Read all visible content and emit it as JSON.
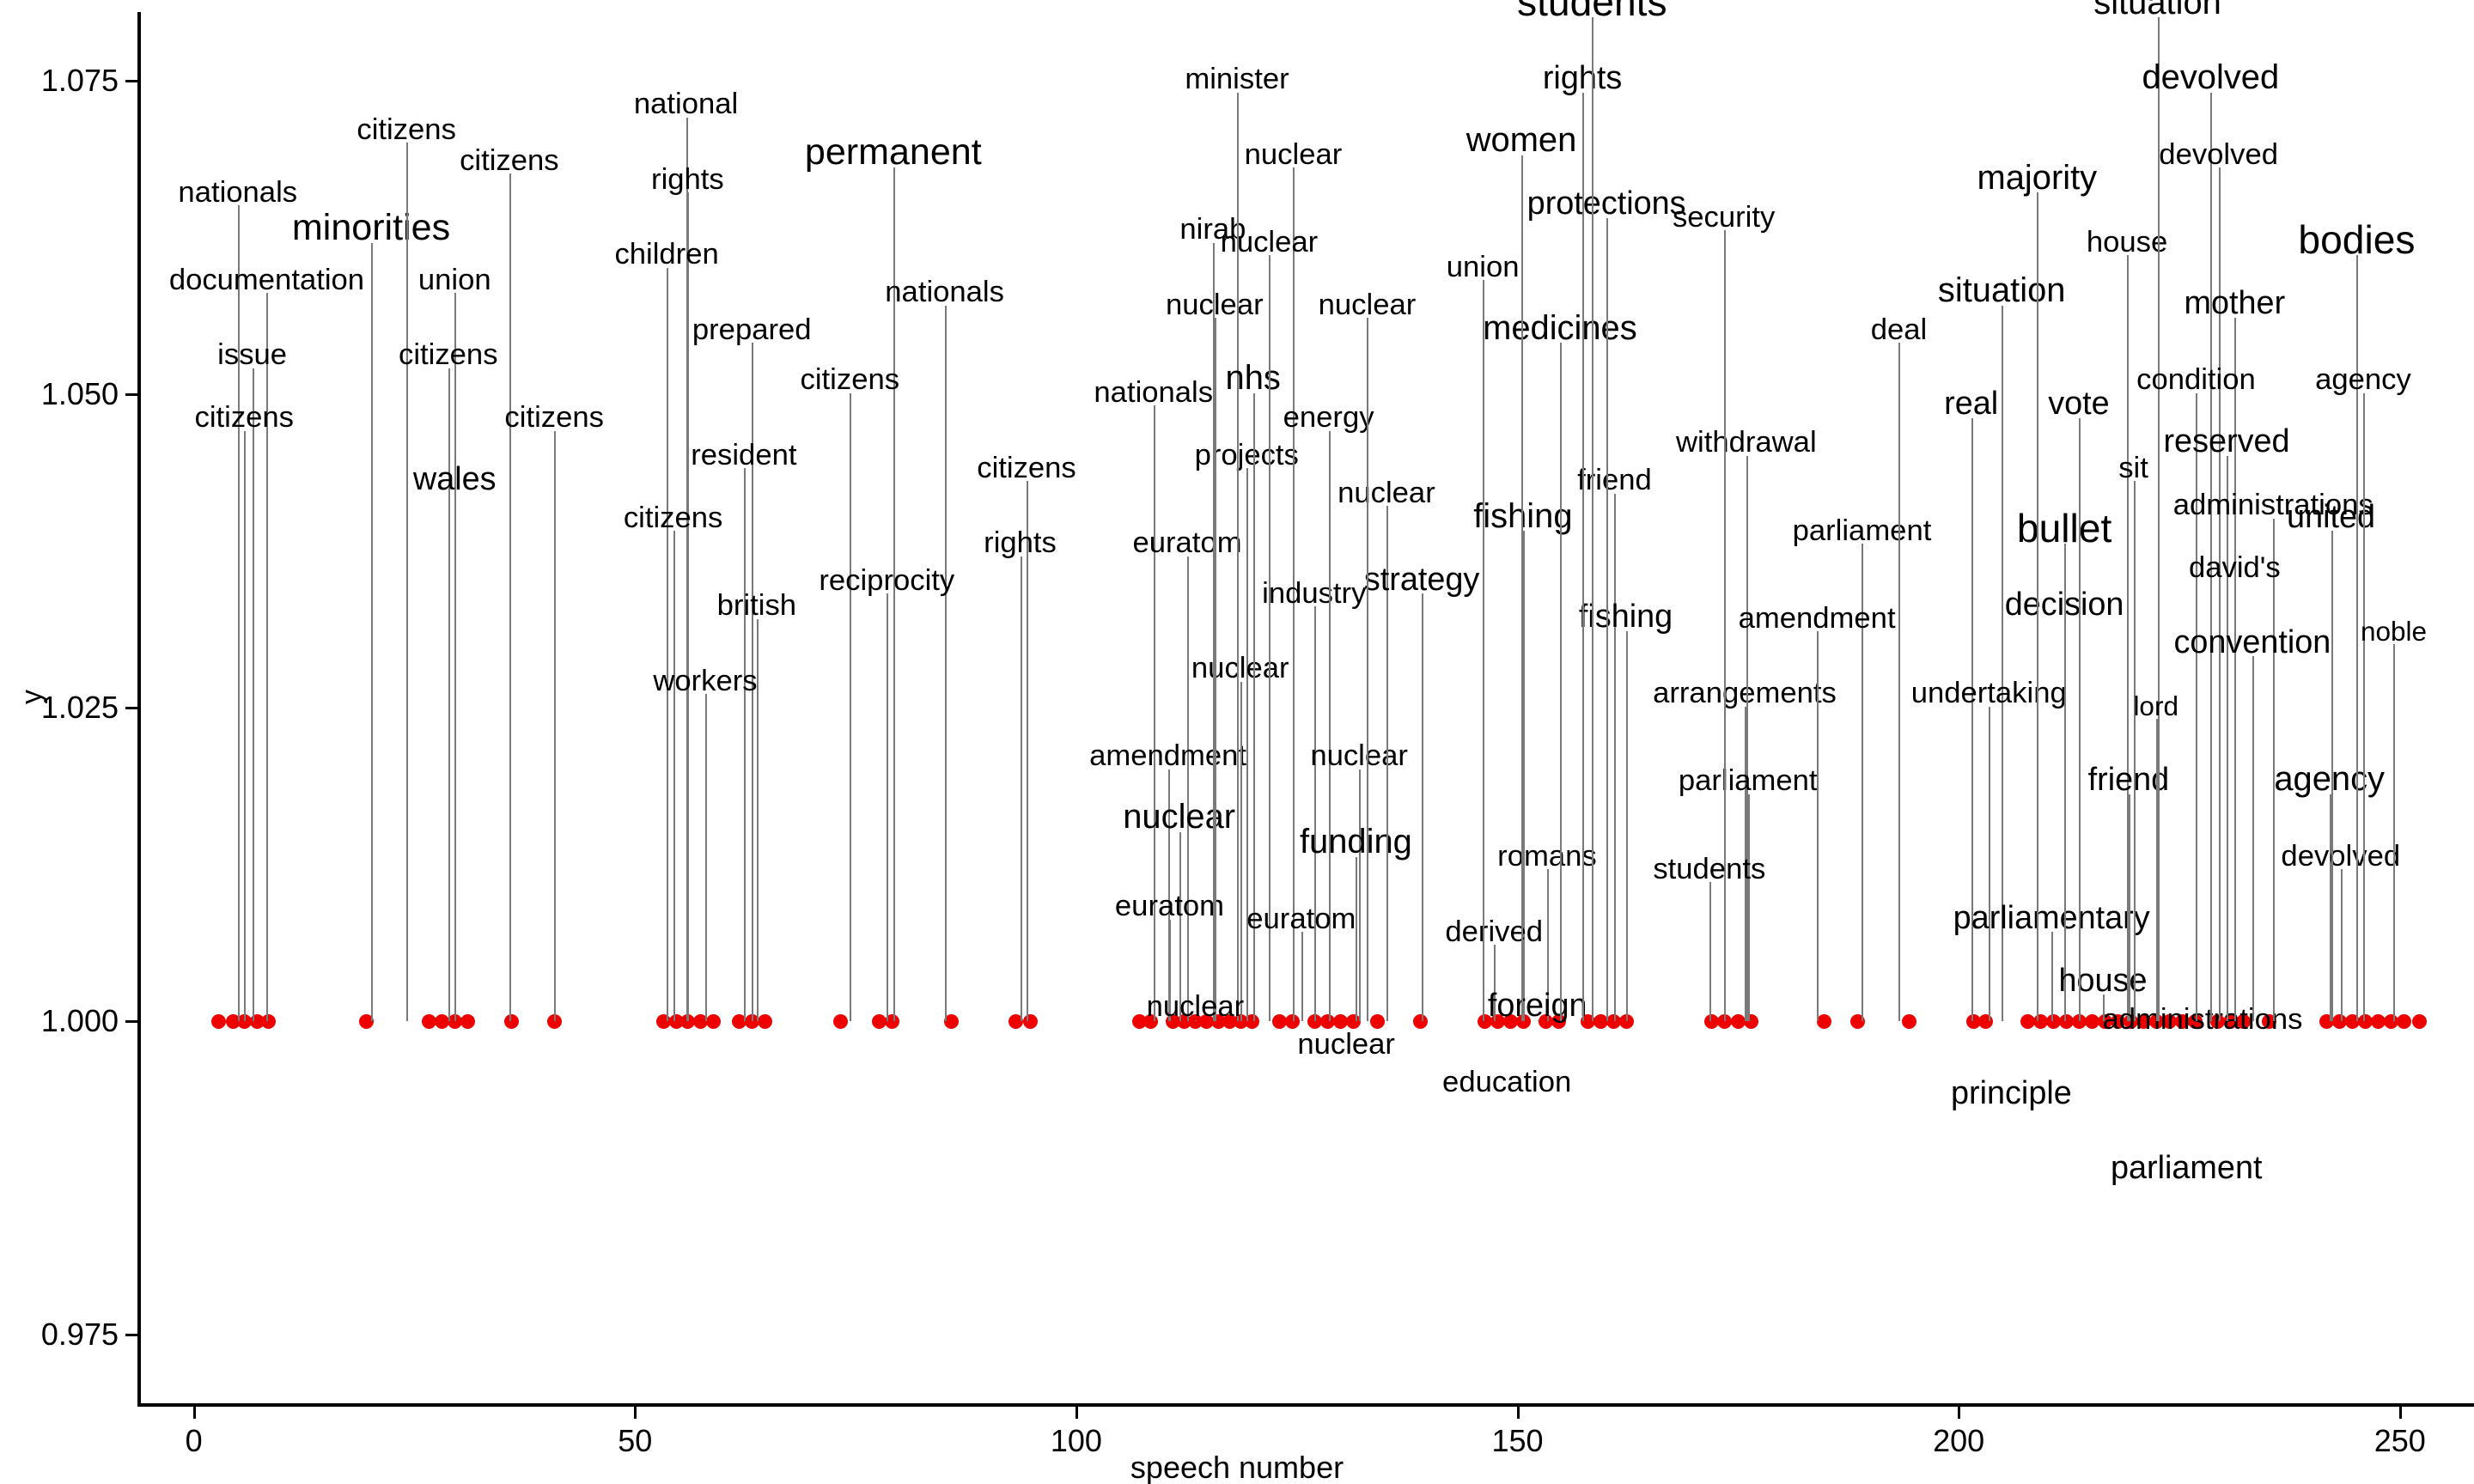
{
  "chart_data": {
    "type": "scatter",
    "title": "",
    "subtitle": "",
    "xlabel": "speech number",
    "ylabel": "y",
    "xlim": [
      -6,
      258
    ],
    "ylim": [
      0.9695,
      1.0805
    ],
    "grid": false,
    "legend": "none",
    "point_color": "#ee0000",
    "stem_color": "#7a7a7a",
    "xticks": [
      0,
      50,
      100,
      150,
      200,
      250
    ],
    "xtick_labels": [
      "0",
      "50",
      "100",
      "150",
      "200",
      "250"
    ],
    "yticks": [
      0.975,
      1.0,
      1.025,
      1.05,
      1.075
    ],
    "ytick_labels": [
      "0.975",
      "1.000",
      "1.025",
      "1.050",
      "1.075"
    ],
    "series_note": "every point lies at y = 1.000; each point carries a text label placed above it and joined by a thin leader line",
    "points": [
      {
        "x": 2,
        "y": 1.0,
        "label": "nationals",
        "label_y": 1.0655,
        "size": 33,
        "lx": 148
      },
      {
        "x": 3,
        "y": 1.0,
        "label": "documentation",
        "label_y": 1.0585,
        "size": 33,
        "lx": 166
      },
      {
        "x": 3,
        "y": 1.0,
        "label": "issue",
        "label_y": 1.0525,
        "size": 33,
        "lx": 157
      },
      {
        "x": 4,
        "y": 1.0,
        "label": "citizens",
        "label_y": 1.0475,
        "size": 33,
        "lx": 152
      },
      {
        "x": 5,
        "y": 1.0,
        "label": "minorities",
        "label_y": 1.0625,
        "size": 41,
        "lx": 231
      },
      {
        "x": 16,
        "y": 1.0,
        "label": "citizens",
        "label_y": 1.0705,
        "size": 33,
        "lx": 253
      },
      {
        "x": 23,
        "y": 1.0,
        "label": "union",
        "label_y": 1.0585,
        "size": 33,
        "lx": 283
      },
      {
        "x": 24,
        "y": 1.0,
        "label": "citizens",
        "label_y": 1.068,
        "size": 33,
        "lx": 317
      },
      {
        "x": 25,
        "y": 1.0,
        "label": "citizens",
        "label_y": 1.0525,
        "size": 33,
        "lx": 279
      },
      {
        "x": 26,
        "y": 1.0,
        "label": "wales",
        "label_y": 1.0425,
        "size": 36,
        "lx": 283
      },
      {
        "x": 27,
        "y": 1.0,
        "label": "citizens",
        "label_y": 1.0475,
        "size": 33,
        "lx": 345
      },
      {
        "x": 33,
        "y": 1.0,
        "label": "",
        "label_y": 1.0,
        "size": 0,
        "lx": 0
      },
      {
        "x": 37,
        "y": 1.0,
        "label": "",
        "label_y": 1.0,
        "size": 0,
        "lx": 0
      },
      {
        "x": 50,
        "y": 1.0,
        "label": "national",
        "label_y": 1.0725,
        "size": 33,
        "lx": 427
      },
      {
        "x": 51,
        "y": 1.0,
        "label": "rights",
        "label_y": 1.0665,
        "size": 33,
        "lx": 428
      },
      {
        "x": 51,
        "y": 1.0,
        "label": "children",
        "label_y": 1.0605,
        "size": 33,
        "lx": 415
      },
      {
        "x": 52,
        "y": 1.0,
        "label": "prepared",
        "label_y": 1.0545,
        "size": 33,
        "lx": 468
      },
      {
        "x": 53,
        "y": 1.0,
        "label": "resident",
        "label_y": 1.0445,
        "size": 33,
        "lx": 463
      },
      {
        "x": 53,
        "y": 1.0,
        "label": "citizens",
        "label_y": 1.0395,
        "size": 33,
        "lx": 419
      },
      {
        "x": 54,
        "y": 1.0,
        "label": "british",
        "label_y": 1.0325,
        "size": 33,
        "lx": 471
      },
      {
        "x": 55,
        "y": 1.0,
        "label": "workers",
        "label_y": 1.0265,
        "size": 33,
        "lx": 439
      },
      {
        "x": 59,
        "y": 1.0,
        "label": "permanent",
        "label_y": 1.0685,
        "size": 41,
        "lx": 556
      },
      {
        "x": 60,
        "y": 1.0,
        "label": "citizens",
        "label_y": 1.0505,
        "size": 33,
        "lx": 529
      },
      {
        "x": 61,
        "y": 1.0,
        "label": "nationals",
        "label_y": 1.0575,
        "size": 33,
        "lx": 588
      },
      {
        "x": 71,
        "y": 1.0,
        "label": "reciprocity",
        "label_y": 1.0345,
        "size": 33,
        "lx": 552
      },
      {
        "x": 75,
        "y": 1.0,
        "label": "citizens",
        "label_y": 1.0435,
        "size": 33,
        "lx": 639
      },
      {
        "x": 76,
        "y": 1.0,
        "label": "rights",
        "label_y": 1.0375,
        "size": 33,
        "lx": 635
      },
      {
        "x": 84,
        "y": 1.0,
        "label": "",
        "label_y": 1.0,
        "size": 0,
        "lx": 0
      },
      {
        "x": 91,
        "y": 1.0,
        "label": "",
        "label_y": 1.0,
        "size": 0,
        "lx": 0
      },
      {
        "x": 92,
        "y": 1.0,
        "label": "",
        "label_y": 1.0,
        "size": 0,
        "lx": 0
      },
      {
        "x": 105,
        "y": 1.0,
        "label": "nationals",
        "label_y": 1.0495,
        "size": 33,
        "lx": 718
      },
      {
        "x": 107,
        "y": 1.0,
        "label": "euratom",
        "label_y": 1.0375,
        "size": 33,
        "lx": 739
      },
      {
        "x": 108,
        "y": 1.0,
        "label": "projects",
        "label_y": 1.0445,
        "size": 33,
        "lx": 776
      },
      {
        "x": 109,
        "y": 1.0,
        "label": "amendment",
        "label_y": 1.0205,
        "size": 33,
        "lx": 727
      },
      {
        "x": 110,
        "y": 1.0,
        "label": "nuclear",
        "label_y": 1.0275,
        "size": 33,
        "lx": 772
      },
      {
        "x": 111,
        "y": 1.0,
        "label": "nuclear",
        "label_y": 1.0155,
        "size": 38,
        "lx": 734
      },
      {
        "x": 112,
        "y": 1.0,
        "label": "euratom",
        "label_y": 1.0085,
        "size": 33,
        "lx": 728
      },
      {
        "x": 113,
        "y": 1.0,
        "label": "nirab",
        "label_y": 1.0625,
        "size": 33,
        "lx": 755
      },
      {
        "x": 114,
        "y": 1.0,
        "label": "nuclear",
        "label_y": 1.0565,
        "size": 33,
        "lx": 756
      },
      {
        "x": 115,
        "y": 1.0,
        "label": "minister",
        "label_y": 1.0745,
        "size": 33,
        "lx": 770
      },
      {
        "x": 116,
        "y": 1.0,
        "label": "nuclear",
        "label_y": 1.0685,
        "size": 33,
        "lx": 805
      },
      {
        "x": 117,
        "y": 1.0,
        "label": "nhs",
        "label_y": 1.0505,
        "size": 38,
        "lx": 780
      },
      {
        "x": 118,
        "y": 1.0,
        "label": "nuclear",
        "label_y": 1.0615,
        "size": 33,
        "lx": 790
      },
      {
        "x": 119,
        "y": 1.0,
        "label": "nuclear",
        "label_y": 1.0005,
        "size": 33,
        "lx": 744
      },
      {
        "x": 121,
        "y": 1.0,
        "label": "industry",
        "label_y": 1.0335,
        "size": 33,
        "lx": 818
      },
      {
        "x": 122,
        "y": 1.0,
        "label": "energy",
        "label_y": 1.0475,
        "size": 33,
        "lx": 827
      },
      {
        "x": 123,
        "y": 1.0,
        "label": "euratom",
        "label_y": 1.0075,
        "size": 33,
        "lx": 810
      },
      {
        "x": 124,
        "y": 1.0,
        "label": "nuclear",
        "label_y": 1.0205,
        "size": 33,
        "lx": 846
      },
      {
        "x": 125,
        "y": 1.0,
        "label": "funding",
        "label_y": 1.0135,
        "size": 38,
        "lx": 844
      },
      {
        "x": 126,
        "y": 1.0,
        "label": "nuclear",
        "label_y": 0.9975,
        "size": 33,
        "lx": 838
      },
      {
        "x": 128,
        "y": 1.0,
        "label": "nuclear",
        "label_y": 1.0415,
        "size": 33,
        "lx": 863
      },
      {
        "x": 130,
        "y": 1.0,
        "label": "strategy",
        "label_y": 1.0345,
        "size": 36,
        "lx": 885
      },
      {
        "x": 133,
        "y": 1.0,
        "label": "nuclear",
        "label_y": 1.0565,
        "size": 33,
        "lx": 851
      },
      {
        "x": 139,
        "y": 1.0,
        "label": "",
        "label_y": 1.0,
        "size": 0,
        "lx": 0
      },
      {
        "x": 145,
        "y": 1.0,
        "label": "fishing",
        "label_y": 1.0395,
        "size": 38,
        "lx": 948
      },
      {
        "x": 146,
        "y": 1.0,
        "label": "romans",
        "label_y": 1.0125,
        "size": 33,
        "lx": 963
      },
      {
        "x": 147,
        "y": 1.0,
        "label": "derived",
        "label_y": 1.0065,
        "size": 33,
        "lx": 930
      },
      {
        "x": 148,
        "y": 1.0,
        "label": "foreign",
        "label_y": 1.0005,
        "size": 36,
        "lx": 957
      },
      {
        "x": 149,
        "y": 1.0,
        "label": "education",
        "label_y": 0.9945,
        "size": 33,
        "lx": 938
      },
      {
        "x": 151,
        "y": 1.0,
        "label": "friend",
        "label_y": 1.0425,
        "size": 33,
        "lx": 1005
      },
      {
        "x": 153,
        "y": 1.0,
        "label": "fishing",
        "label_y": 1.0315,
        "size": 36,
        "lx": 1012
      },
      {
        "x": 155,
        "y": 1.0,
        "label": "medicines",
        "label_y": 1.0545,
        "size": 38,
        "lx": 971
      },
      {
        "x": 157,
        "y": 1.0,
        "label": "union",
        "label_y": 1.0595,
        "size": 33,
        "lx": 923
      },
      {
        "x": 158,
        "y": 1.0,
        "label": "protections",
        "label_y": 1.0645,
        "size": 36,
        "lx": 1000
      },
      {
        "x": 158,
        "y": 1.0,
        "label": "women",
        "label_y": 1.0695,
        "size": 38,
        "lx": 947
      },
      {
        "x": 159,
        "y": 1.0,
        "label": "rights",
        "label_y": 1.0745,
        "size": 36,
        "lx": 985
      },
      {
        "x": 159,
        "y": 1.0,
        "label": "students",
        "label_y": 1.0805,
        "size": 44,
        "lx": 991
      },
      {
        "x": 160,
        "y": 1.0,
        "label": "",
        "label_y": 1.0,
        "size": 0,
        "lx": 0
      },
      {
        "x": 170,
        "y": 1.0,
        "label": "arrangements",
        "label_y": 1.0255,
        "size": 33,
        "lx": 1086
      },
      {
        "x": 172,
        "y": 1.0,
        "label": "withdrawal",
        "label_y": 1.0455,
        "size": 33,
        "lx": 1087
      },
      {
        "x": 173,
        "y": 1.0,
        "label": "parliament",
        "label_y": 1.0185,
        "size": 33,
        "lx": 1088
      },
      {
        "x": 174,
        "y": 1.0,
        "label": "security",
        "label_y": 1.0635,
        "size": 33,
        "lx": 1073
      },
      {
        "x": 174,
        "y": 1.0,
        "label": "parliament",
        "label_y": 1.0385,
        "size": 33,
        "lx": 1159
      },
      {
        "x": 175,
        "y": 1.0,
        "label": "amendment",
        "label_y": 1.0315,
        "size": 33,
        "lx": 1131
      },
      {
        "x": 176,
        "y": 1.0,
        "label": "students",
        "label_y": 1.0115,
        "size": 33,
        "lx": 1064
      },
      {
        "x": 183,
        "y": 1.0,
        "label": "deal",
        "label_y": 1.0545,
        "size": 33,
        "lx": 1182
      },
      {
        "x": 188,
        "y": 1.0,
        "label": "",
        "label_y": 1.0,
        "size": 0,
        "lx": 0
      },
      {
        "x": 193,
        "y": 1.0,
        "label": "",
        "label_y": 1.0,
        "size": 0,
        "lx": 0
      },
      {
        "x": 201,
        "y": 1.0,
        "label": "situation",
        "label_y": 1.0575,
        "size": 38,
        "lx": 1246
      },
      {
        "x": 203,
        "y": 1.0,
        "label": "real",
        "label_y": 1.0485,
        "size": 36,
        "lx": 1227
      },
      {
        "x": 205,
        "y": 1.0,
        "label": "undertaking",
        "label_y": 1.0255,
        "size": 33,
        "lx": 1238
      },
      {
        "x": 206,
        "y": 1.0,
        "label": "principle",
        "label_y": 0.9935,
        "size": 36,
        "lx": 1252
      },
      {
        "x": 207,
        "y": 1.0,
        "label": "decision",
        "label_y": 1.0325,
        "size": 36,
        "lx": 1285
      },
      {
        "x": 208,
        "y": 1.0,
        "label": "parliamentary",
        "label_y": 1.0075,
        "size": 36,
        "lx": 1277
      },
      {
        "x": 209,
        "y": 1.0,
        "label": "bullet",
        "label_y": 1.0385,
        "size": 44,
        "lx": 1285
      },
      {
        "x": 210,
        "y": 1.0,
        "label": "majority",
        "label_y": 1.0665,
        "size": 38,
        "lx": 1268
      },
      {
        "x": 212,
        "y": 1.0,
        "label": "house",
        "label_y": 1.0025,
        "size": 36,
        "lx": 1309
      },
      {
        "x": 214,
        "y": 1.0,
        "label": "house",
        "label_y": 1.0615,
        "size": 33,
        "lx": 1324
      },
      {
        "x": 215,
        "y": 1.0,
        "label": "friend",
        "label_y": 1.0185,
        "size": 36,
        "lx": 1325
      },
      {
        "x": 216,
        "y": 1.0,
        "label": "vote",
        "label_y": 1.0485,
        "size": 36,
        "lx": 1294
      },
      {
        "x": 217,
        "y": 1.0,
        "label": "parliament",
        "label_y": 0.9875,
        "size": 36,
        "lx": 1361
      },
      {
        "x": 218,
        "y": 1.0,
        "label": "administrations",
        "label_y": 0.9995,
        "size": 33,
        "lx": 1371
      },
      {
        "x": 219,
        "y": 1.0,
        "label": "sit",
        "label_y": 1.0435,
        "size": 33,
        "lx": 1328
      },
      {
        "x": 220,
        "y": 1.0,
        "label": "situation",
        "label_y": 1.0805,
        "size": 38,
        "lx": 1343
      },
      {
        "x": 221,
        "y": 1.0,
        "label": "devolved",
        "label_y": 1.0745,
        "size": 38,
        "lx": 1376
      },
      {
        "x": 222,
        "y": 1.0,
        "label": "devolved",
        "label_y": 1.0685,
        "size": 33,
        "lx": 1381
      },
      {
        "x": 223,
        "y": 1.0,
        "label": "mother",
        "label_y": 1.0565,
        "size": 36,
        "lx": 1391
      },
      {
        "x": 224,
        "y": 1.0,
        "label": "condition",
        "label_y": 1.0505,
        "size": 33,
        "lx": 1367
      },
      {
        "x": 225,
        "y": 1.0,
        "label": "reserved",
        "label_y": 1.0455,
        "size": 36,
        "lx": 1386
      },
      {
        "x": 226,
        "y": 1.0,
        "label": "administrations",
        "label_y": 1.0405,
        "size": 33,
        "lx": 1415
      },
      {
        "x": 227,
        "y": 1.0,
        "label": "david's",
        "label_y": 1.0355,
        "size": 33,
        "lx": 1391
      },
      {
        "x": 228,
        "y": 1.0,
        "label": "convention",
        "label_y": 1.0295,
        "size": 36,
        "lx": 1402
      },
      {
        "x": 229,
        "y": 1.0,
        "label": "lord",
        "label_y": 1.0245,
        "size": 30,
        "lx": 1342
      },
      {
        "x": 230,
        "y": 1.0,
        "label": "agency",
        "label_y": 1.0185,
        "size": 38,
        "lx": 1450
      },
      {
        "x": 231,
        "y": 1.0,
        "label": "devolved",
        "label_y": 1.0125,
        "size": 33,
        "lx": 1457
      },
      {
        "x": 234,
        "y": 1.0,
        "label": "united",
        "label_y": 1.0395,
        "size": 36,
        "lx": 1451
      },
      {
        "x": 236,
        "y": 1.0,
        "label": "bodies",
        "label_y": 1.0615,
        "size": 44,
        "lx": 1467
      },
      {
        "x": 241,
        "y": 1.0,
        "label": "agency",
        "label_y": 1.0505,
        "size": 33,
        "lx": 1471
      },
      {
        "x": 246,
        "y": 1.0,
        "label": "noble",
        "label_y": 1.0305,
        "size": 30,
        "lx": 1490
      },
      {
        "x": 250,
        "y": 1.0,
        "label": "",
        "label_y": 1.0,
        "size": 0,
        "lx": 0
      }
    ],
    "dot_positions": [
      136,
      145,
      152,
      160,
      167,
      228,
      267,
      275,
      283,
      291,
      318,
      345,
      413,
      421,
      428,
      436,
      444,
      460,
      468,
      476,
      523,
      547,
      555,
      592,
      632,
      641,
      709,
      716,
      730,
      737,
      744,
      751,
      758,
      765,
      772,
      779,
      796,
      804,
      818,
      826,
      834,
      842,
      857,
      884,
      924,
      932,
      940,
      948,
      962,
      970,
      988,
      996,
      1004,
      1012,
      1065,
      1073,
      1082,
      1090,
      1135,
      1156,
      1188,
      1228,
      1236,
      1262,
      1270,
      1278,
      1286,
      1294,
      1302,
      1310,
      1318,
      1326,
      1334,
      1342,
      1350,
      1358,
      1366,
      1380,
      1388,
      1396,
      1412,
      1448,
      1456,
      1464,
      1472,
      1480,
      1488,
      1496,
      1506
    ]
  },
  "axes": {
    "y_title": "y",
    "x_title": "speech number"
  }
}
